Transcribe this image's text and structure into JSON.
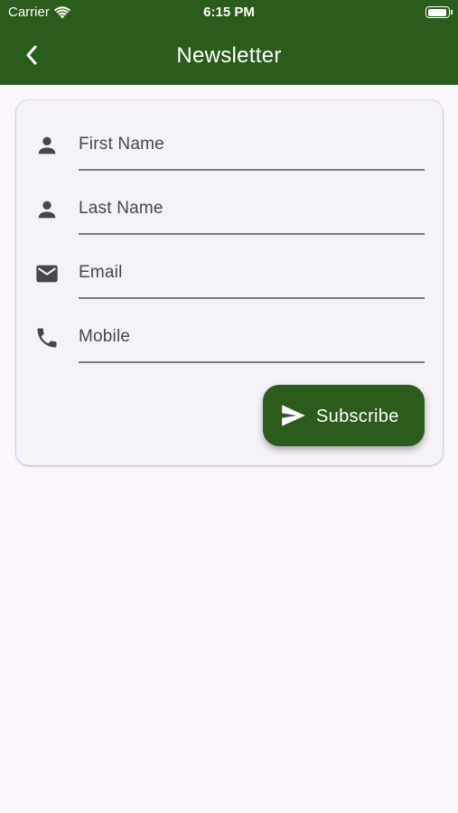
{
  "status_bar": {
    "carrier": "Carrier",
    "time": "6:15 PM"
  },
  "app_bar": {
    "title": "Newsletter",
    "background": "#2b5c1b"
  },
  "form": {
    "fields": [
      {
        "placeholder": "First Name",
        "icon": "person-icon"
      },
      {
        "placeholder": "Last Name",
        "icon": "person-icon"
      },
      {
        "placeholder": "Email",
        "icon": "mail-icon"
      },
      {
        "placeholder": "Mobile",
        "icon": "phone-icon"
      }
    ],
    "subscribe_label": "Subscribe",
    "subscribe_icon": "send-icon"
  },
  "colors": {
    "accent": "#2b5c1b",
    "page_background": "#fcf6fd",
    "card_background": "#f5f2f8",
    "icon": "#47464f"
  }
}
